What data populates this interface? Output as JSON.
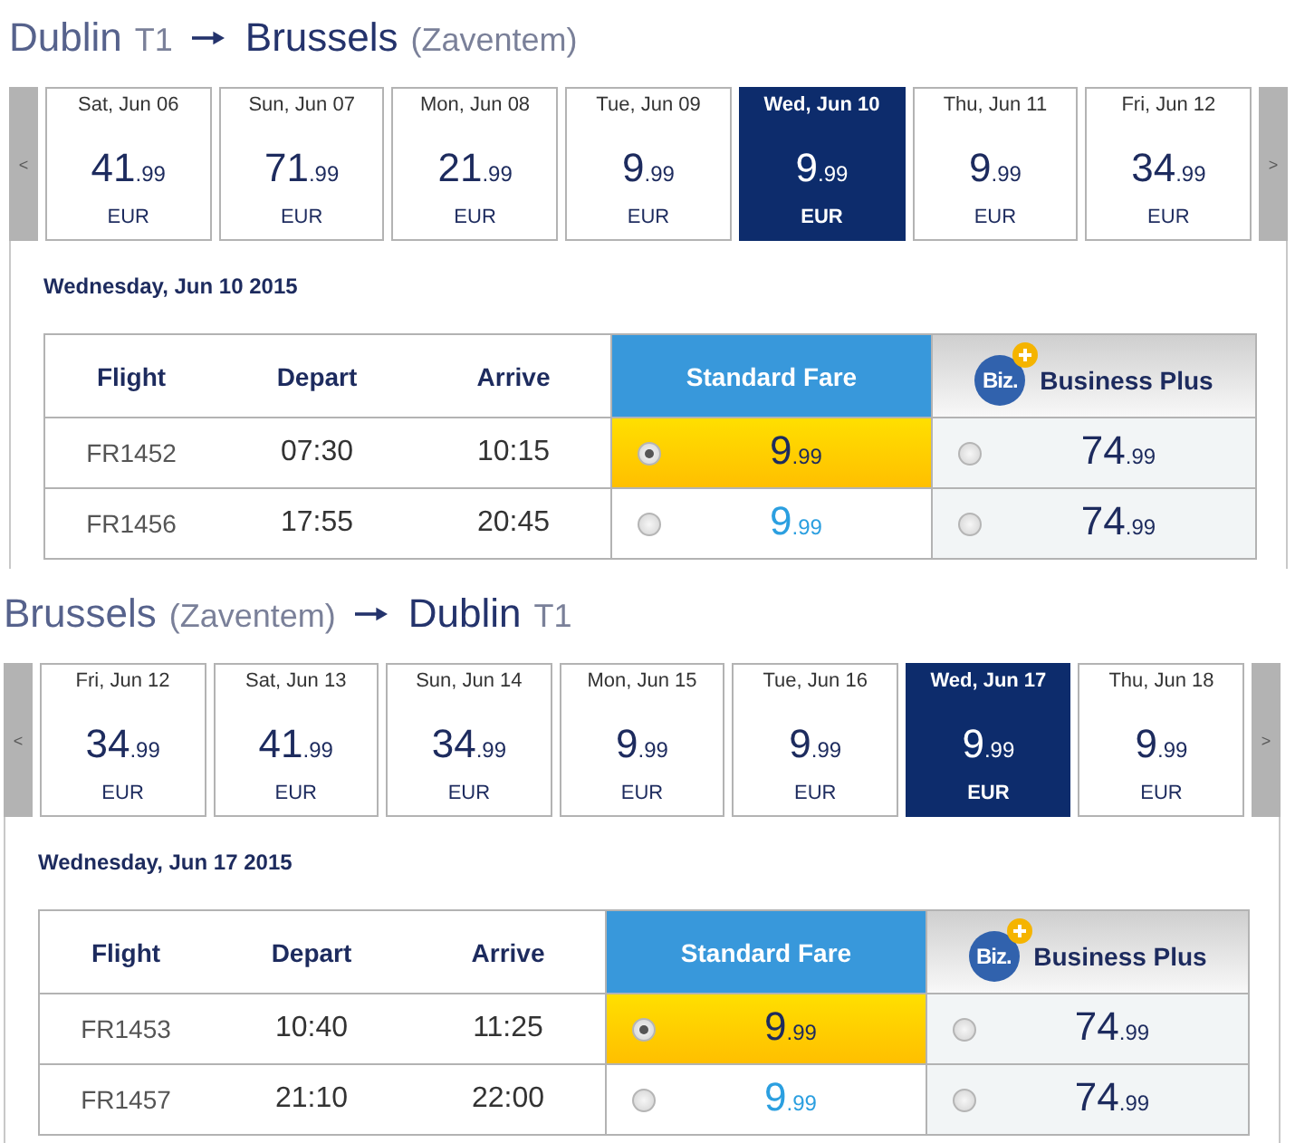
{
  "journeys": [
    {
      "route": {
        "from": {
          "city": "Dublin",
          "airport": "T1"
        },
        "to": {
          "city": "Brussels",
          "airport": "(Zaventem)"
        }
      },
      "prev": "<",
      "next": ">",
      "dates": [
        {
          "label": "Sat, Jun 06",
          "amount": "41",
          "cents": ".99",
          "currency": "EUR",
          "selected": false
        },
        {
          "label": "Sun, Jun 07",
          "amount": "71",
          "cents": ".99",
          "currency": "EUR",
          "selected": false
        },
        {
          "label": "Mon, Jun 08",
          "amount": "21",
          "cents": ".99",
          "currency": "EUR",
          "selected": false
        },
        {
          "label": "Tue, Jun 09",
          "amount": "9",
          "cents": ".99",
          "currency": "EUR",
          "selected": false
        },
        {
          "label": "Wed, Jun 10",
          "amount": "9",
          "cents": ".99",
          "currency": "EUR",
          "selected": true
        },
        {
          "label": "Thu, Jun 11",
          "amount": "9",
          "cents": ".99",
          "currency": "EUR",
          "selected": false
        },
        {
          "label": "Fri, Jun 12",
          "amount": "34",
          "cents": ".99",
          "currency": "EUR",
          "selected": false
        }
      ],
      "heading": "Wednesday, Jun 10 2015",
      "table": {
        "columns": [
          {
            "label": "Flight",
            "kind": "text"
          },
          {
            "label": "Depart",
            "kind": "text"
          },
          {
            "label": "Arrive",
            "kind": "text"
          },
          {
            "label": "Standard Fare",
            "kind": "standard"
          },
          {
            "label": "Business Plus",
            "kind": "business",
            "logo": "Biz."
          }
        ],
        "rows": [
          {
            "flight": "FR1452",
            "depart": "07:30",
            "arrive": "10:15",
            "standard": {
              "amount": "9",
              "cents": ".99",
              "selected": true
            },
            "business": {
              "amount": "74",
              "cents": ".99",
              "selected": false
            }
          },
          {
            "flight": "FR1456",
            "depart": "17:55",
            "arrive": "20:45",
            "standard": {
              "amount": "9",
              "cents": ".99",
              "selected": false
            },
            "business": {
              "amount": "74",
              "cents": ".99",
              "selected": false
            }
          }
        ]
      }
    },
    {
      "route": {
        "from": {
          "city": "Brussels",
          "airport": "(Zaventem)"
        },
        "to": {
          "city": "Dublin",
          "airport": "T1"
        }
      },
      "prev": "<",
      "next": ">",
      "dates": [
        {
          "label": "Fri, Jun 12",
          "amount": "34",
          "cents": ".99",
          "currency": "EUR",
          "selected": false
        },
        {
          "label": "Sat, Jun 13",
          "amount": "41",
          "cents": ".99",
          "currency": "EUR",
          "selected": false
        },
        {
          "label": "Sun, Jun 14",
          "amount": "34",
          "cents": ".99",
          "currency": "EUR",
          "selected": false
        },
        {
          "label": "Mon, Jun 15",
          "amount": "9",
          "cents": ".99",
          "currency": "EUR",
          "selected": false
        },
        {
          "label": "Tue, Jun 16",
          "amount": "9",
          "cents": ".99",
          "currency": "EUR",
          "selected": false
        },
        {
          "label": "Wed, Jun 17",
          "amount": "9",
          "cents": ".99",
          "currency": "EUR",
          "selected": true
        },
        {
          "label": "Thu, Jun 18",
          "amount": "9",
          "cents": ".99",
          "currency": "EUR",
          "selected": false
        }
      ],
      "heading": "Wednesday, Jun 17 2015",
      "table": {
        "columns": [
          {
            "label": "Flight",
            "kind": "text"
          },
          {
            "label": "Depart",
            "kind": "text"
          },
          {
            "label": "Arrive",
            "kind": "text"
          },
          {
            "label": "Standard Fare",
            "kind": "standard"
          },
          {
            "label": "Business Plus",
            "kind": "business",
            "logo": "Biz."
          }
        ],
        "rows": [
          {
            "flight": "FR1453",
            "depart": "10:40",
            "arrive": "11:25",
            "standard": {
              "amount": "9",
              "cents": ".99",
              "selected": true
            },
            "business": {
              "amount": "74",
              "cents": ".99",
              "selected": false
            }
          },
          {
            "flight": "FR1457",
            "depart": "21:10",
            "arrive": "22:00",
            "standard": {
              "amount": "9",
              "cents": ".99",
              "selected": false
            },
            "business": {
              "amount": "74",
              "cents": ".99",
              "selected": false
            }
          }
        ]
      }
    }
  ]
}
